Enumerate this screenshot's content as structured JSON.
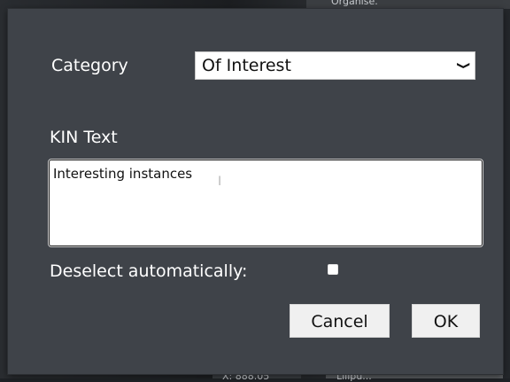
{
  "background": {
    "top_fragment": "Organise.",
    "bottom_left_fragment": "X: 888.05",
    "bottom_right_fragment": "Lilipu..."
  },
  "dialog": {
    "category_label": "Category",
    "category_value": "Of Interest",
    "kin_text_label": "KIN Text",
    "kin_text_value": "Interesting instances",
    "deselect_label": "Deselect automatically:",
    "deselect_checked": false,
    "cancel_label": "Cancel",
    "ok_label": "OK"
  },
  "colors": {
    "dialog_bg": "#3f4349",
    "text": "#ffffff",
    "button_bg": "#f0f0f0"
  }
}
